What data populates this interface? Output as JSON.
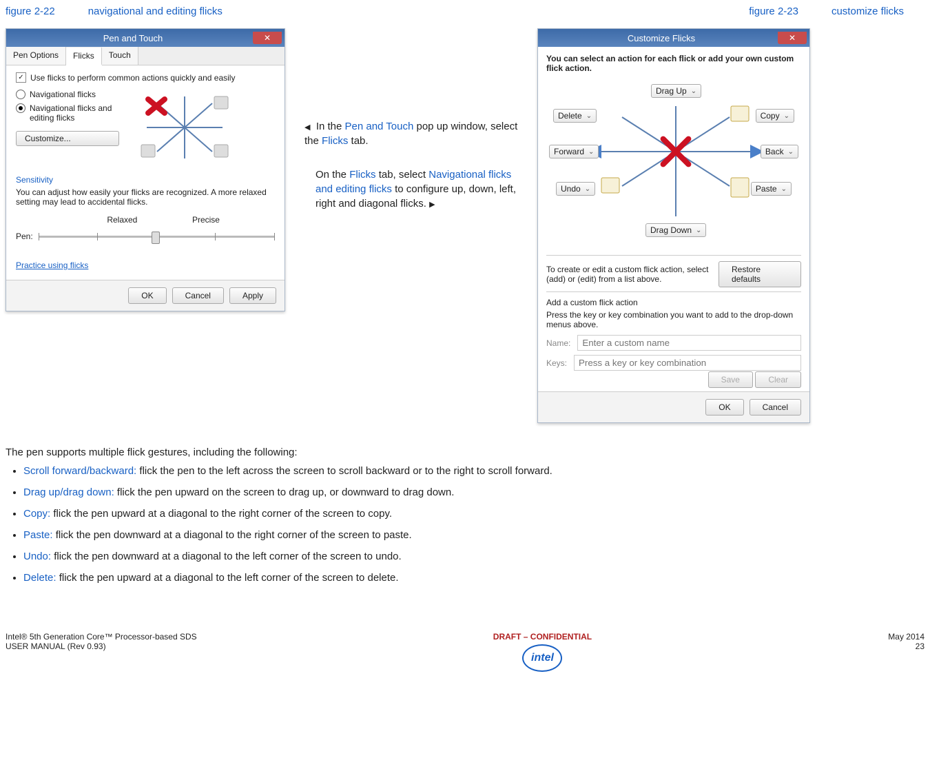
{
  "captions": {
    "left_fig": "figure 2-22",
    "left_title": "navigational and editing flicks",
    "right_fig": "figure 2-23",
    "right_title": "customize flicks"
  },
  "pen_touch": {
    "title": "Pen and Touch",
    "tabs": [
      "Pen Options",
      "Flicks",
      "Touch"
    ],
    "use_flicks": "Use flicks to perform common actions quickly and easily",
    "opt_nav": "Navigational flicks",
    "opt_nav_edit": "Navigational flicks and editing flicks",
    "customize_btn": "Customize...",
    "sensitivity": "Sensitivity",
    "sens_text": "You can adjust how easily your flicks are recognized. A more relaxed setting may lead to accidental flicks.",
    "relaxed": "Relaxed",
    "precise": "Precise",
    "pen_lbl": "Pen:",
    "practice": "Practice using flicks",
    "ok": "OK",
    "cancel": "Cancel",
    "apply": "Apply"
  },
  "mid": {
    "p1a": "In the ",
    "p1b": "Pen and Touch",
    "p1c": " pop up window, select the ",
    "p1d": "Flicks",
    "p1e": " tab.",
    "p2a": "On the ",
    "p2b": "Flicks",
    "p2c": " tab, select ",
    "p2d": "Navigational flicks and editing flicks",
    "p2e": " to configure up, down, left, right and diagonal flicks.  "
  },
  "customize": {
    "title": "Customize Flicks",
    "desc": "You can select an action for each flick or add your own custom flick action.",
    "drag_up": "Drag Up",
    "delete": "Delete",
    "copy": "Copy",
    "forward": "Forward",
    "back": "Back",
    "undo": "Undo",
    "paste": "Paste",
    "drag_down": "Drag Down",
    "create_text": "To create or edit a custom flick action, select (add) or (edit) from a list above.",
    "restore": "Restore defaults",
    "add_lbl": "Add a custom flick action",
    "add_text": "Press the key or key combination you want to add to the drop-down menus above.",
    "name_lbl": "Name:",
    "name_ph": "Enter a custom name",
    "keys_lbl": "Keys:",
    "keys_ph": "Press a key or key combination",
    "save": "Save",
    "clear": "Clear",
    "ok": "OK",
    "cancel": "Cancel"
  },
  "body": {
    "intro": "The pen supports multiple flick gestures, including the following:",
    "items": [
      {
        "k": "Scroll forward/backward:",
        "t": " flick the pen to the left across the screen to scroll backward or to the right to scroll forward."
      },
      {
        "k": "Drag up/drag down:",
        "t": " flick the pen upward on the screen to drag up, or downward to drag down."
      },
      {
        "k": "Copy:",
        "t": " flick the pen upward at a diagonal to the right corner of the screen to copy."
      },
      {
        "k": "Paste:",
        "t": " flick the pen downward at a diagonal to the right corner of the screen to paste."
      },
      {
        "k": "Undo:",
        "t": " flick the pen downward at a diagonal to the left corner of the screen to undo."
      },
      {
        "k": "Delete:",
        "t": " flick the pen upward at a diagonal to the left corner of the screen to delete."
      }
    ]
  },
  "footer": {
    "left1": "Intel® 5th Generation Core™ Processor-based SDS",
    "left2": "USER MANUAL (Rev 0.93)",
    "mid": "DRAFT – CONFIDENTIAL",
    "right1": "May 2014",
    "right2": "23",
    "logo": "intel"
  }
}
